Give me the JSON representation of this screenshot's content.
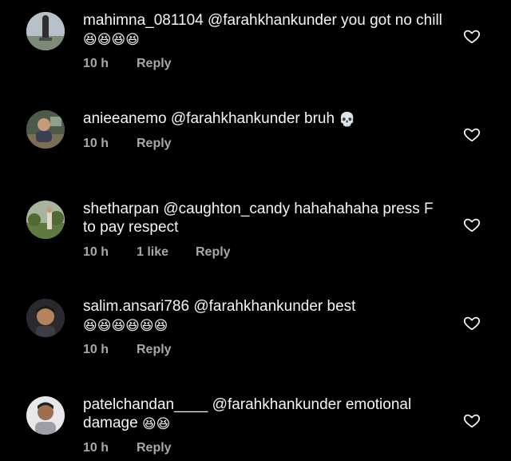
{
  "theme": {
    "background": "#000000",
    "text": "#f5f5f5",
    "muted": "#a8a8a8"
  },
  "comments": [
    {
      "username": "mahimna_081104",
      "text": " @farahkhankunder  you got no chill ",
      "emoji": "😆😆😆😆",
      "time": "10 h",
      "likes": "",
      "reply": "Reply",
      "avatar_icon": "statue-avatar",
      "like_icon": "heart-outline-icon"
    },
    {
      "username": "anieeanemo",
      "text": " @farahkhankunder bruh ",
      "emoji": "💀",
      "time": "10 h",
      "likes": "",
      "reply": "Reply",
      "avatar_icon": "person-avatar",
      "like_icon": "heart-outline-icon"
    },
    {
      "username": "shetharpan",
      "text": " @caughton_candy hahahahaha press F to pay respect",
      "emoji": "",
      "time": "10 h",
      "likes": "1 like",
      "reply": "Reply",
      "avatar_icon": "landscape-avatar",
      "like_icon": "heart-outline-icon"
    },
    {
      "username": "salim.ansari786",
      "text": " @farahkhankunder best ",
      "emoji": "😆😆😆😆😆😆",
      "time": "10 h",
      "likes": "",
      "reply": "Reply",
      "avatar_icon": "selfie-avatar",
      "like_icon": "heart-outline-icon"
    },
    {
      "username": "patelchandan____",
      "text": " @farahkhankunder emotional damage ",
      "emoji": "😆😆",
      "time": "10 h",
      "likes": "",
      "reply": "Reply",
      "avatar_icon": "portrait-avatar",
      "like_icon": "heart-outline-icon"
    }
  ]
}
